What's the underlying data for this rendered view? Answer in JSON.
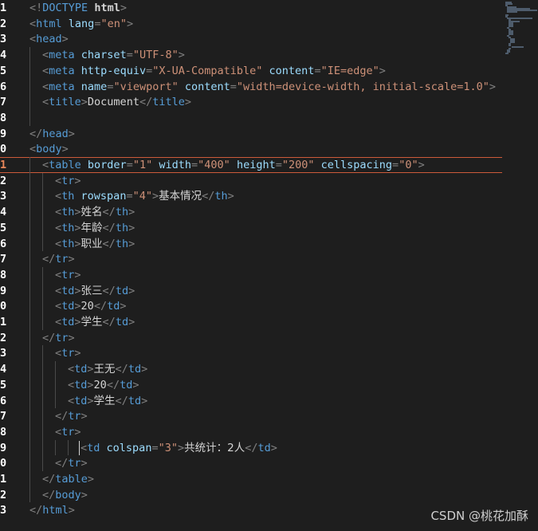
{
  "line_numbers": [
    "1",
    "2",
    "3",
    "4",
    "5",
    "6",
    "7",
    "8",
    "9",
    "0",
    "1",
    "2",
    "3",
    "4",
    "5",
    "6",
    "7",
    "8",
    "9",
    "0",
    "1",
    "2",
    "3",
    "4",
    "5",
    "6",
    "7",
    "8",
    "9",
    "0",
    "1",
    "2",
    "3"
  ],
  "active_line_index": 10,
  "watermark": "CSDN @桃花加酥",
  "lines": [
    {
      "indent": 0,
      "tokens": [
        [
          "punc",
          "<!"
        ],
        [
          "doc",
          "DOCTYPE"
        ],
        [
          "text",
          " "
        ],
        [
          "bold",
          "html"
        ],
        [
          "punc",
          ">"
        ]
      ]
    },
    {
      "indent": 0,
      "tokens": [
        [
          "punc",
          "<"
        ],
        [
          "tag",
          "html"
        ],
        [
          "text",
          " "
        ],
        [
          "attr",
          "lang"
        ],
        [
          "punc",
          "="
        ],
        [
          "str",
          "\"en\""
        ],
        [
          "punc",
          ">"
        ]
      ]
    },
    {
      "indent": 0,
      "tokens": [
        [
          "punc",
          "<"
        ],
        [
          "tag",
          "head"
        ],
        [
          "punc",
          ">"
        ]
      ]
    },
    {
      "indent": 1,
      "tokens": [
        [
          "punc",
          "<"
        ],
        [
          "tag",
          "meta"
        ],
        [
          "text",
          " "
        ],
        [
          "attr",
          "charset"
        ],
        [
          "punc",
          "="
        ],
        [
          "str",
          "\"UTF-8\""
        ],
        [
          "punc",
          ">"
        ]
      ]
    },
    {
      "indent": 1,
      "tokens": [
        [
          "punc",
          "<"
        ],
        [
          "tag",
          "meta"
        ],
        [
          "text",
          " "
        ],
        [
          "attr",
          "http-equiv"
        ],
        [
          "punc",
          "="
        ],
        [
          "str",
          "\"X-UA-Compatible\""
        ],
        [
          "text",
          " "
        ],
        [
          "attr",
          "content"
        ],
        [
          "punc",
          "="
        ],
        [
          "str",
          "\"IE=edge\""
        ],
        [
          "punc",
          ">"
        ]
      ]
    },
    {
      "indent": 1,
      "tokens": [
        [
          "punc",
          "<"
        ],
        [
          "tag",
          "meta"
        ],
        [
          "text",
          " "
        ],
        [
          "attr",
          "name"
        ],
        [
          "punc",
          "="
        ],
        [
          "str",
          "\"viewport\""
        ],
        [
          "text",
          " "
        ],
        [
          "attr",
          "content"
        ],
        [
          "punc",
          "="
        ],
        [
          "str",
          "\"width=device-width, initial-scale=1.0\""
        ],
        [
          "punc",
          ">"
        ]
      ]
    },
    {
      "indent": 1,
      "tokens": [
        [
          "punc",
          "<"
        ],
        [
          "tag",
          "title"
        ],
        [
          "punc",
          ">"
        ],
        [
          "text",
          "Document"
        ],
        [
          "punc",
          "</"
        ],
        [
          "tag",
          "title"
        ],
        [
          "punc",
          ">"
        ]
      ]
    },
    {
      "indent": 1,
      "tokens": []
    },
    {
      "indent": 0,
      "tokens": [
        [
          "punc",
          "</"
        ],
        [
          "tag",
          "head"
        ],
        [
          "punc",
          ">"
        ]
      ]
    },
    {
      "indent": 0,
      "tokens": [
        [
          "punc",
          "<"
        ],
        [
          "tag",
          "body"
        ],
        [
          "punc",
          ">"
        ]
      ]
    },
    {
      "indent": 1,
      "tokens": [
        [
          "punc",
          "<"
        ],
        [
          "tag",
          "table"
        ],
        [
          "text",
          " "
        ],
        [
          "attr",
          "border"
        ],
        [
          "punc",
          "="
        ],
        [
          "str",
          "\"1\""
        ],
        [
          "text",
          " "
        ],
        [
          "attr",
          "width"
        ],
        [
          "punc",
          "="
        ],
        [
          "str",
          "\"400\""
        ],
        [
          "text",
          " "
        ],
        [
          "attr",
          "height"
        ],
        [
          "punc",
          "="
        ],
        [
          "str",
          "\"200\""
        ],
        [
          "text",
          " "
        ],
        [
          "attr",
          "cellspacing"
        ],
        [
          "punc",
          "="
        ],
        [
          "str",
          "\"0\""
        ],
        [
          "punc",
          ">"
        ]
      ]
    },
    {
      "indent": 2,
      "tokens": [
        [
          "punc",
          "<"
        ],
        [
          "tag",
          "tr"
        ],
        [
          "punc",
          ">"
        ]
      ]
    },
    {
      "indent": 2,
      "tokens": [
        [
          "punc",
          "<"
        ],
        [
          "tag",
          "th"
        ],
        [
          "text",
          " "
        ],
        [
          "attr",
          "rowspan"
        ],
        [
          "punc",
          "="
        ],
        [
          "str",
          "\"4\""
        ],
        [
          "punc",
          ">"
        ],
        [
          "cjk",
          "基本情况"
        ],
        [
          "punc",
          "</"
        ],
        [
          "tag",
          "th"
        ],
        [
          "punc",
          ">"
        ]
      ]
    },
    {
      "indent": 2,
      "tokens": [
        [
          "punc",
          "<"
        ],
        [
          "tag",
          "th"
        ],
        [
          "punc",
          ">"
        ],
        [
          "cjk",
          "姓名"
        ],
        [
          "punc",
          "</"
        ],
        [
          "tag",
          "th"
        ],
        [
          "punc",
          ">"
        ]
      ]
    },
    {
      "indent": 2,
      "tokens": [
        [
          "punc",
          "<"
        ],
        [
          "tag",
          "th"
        ],
        [
          "punc",
          ">"
        ],
        [
          "cjk",
          "年龄"
        ],
        [
          "punc",
          "</"
        ],
        [
          "tag",
          "th"
        ],
        [
          "punc",
          ">"
        ]
      ]
    },
    {
      "indent": 2,
      "tokens": [
        [
          "punc",
          "<"
        ],
        [
          "tag",
          "th"
        ],
        [
          "punc",
          ">"
        ],
        [
          "cjk",
          "职业"
        ],
        [
          "punc",
          "</"
        ],
        [
          "tag",
          "th"
        ],
        [
          "punc",
          ">"
        ]
      ]
    },
    {
      "indent": 1,
      "tokens": [
        [
          "punc",
          "</"
        ],
        [
          "tag",
          "tr"
        ],
        [
          "punc",
          ">"
        ]
      ]
    },
    {
      "indent": 2,
      "tokens": [
        [
          "punc",
          "<"
        ],
        [
          "tag",
          "tr"
        ],
        [
          "punc",
          ">"
        ]
      ]
    },
    {
      "indent": 2,
      "tokens": [
        [
          "punc",
          "<"
        ],
        [
          "tag",
          "td"
        ],
        [
          "punc",
          ">"
        ],
        [
          "cjk",
          "张三"
        ],
        [
          "punc",
          "</"
        ],
        [
          "tag",
          "td"
        ],
        [
          "punc",
          ">"
        ]
      ]
    },
    {
      "indent": 2,
      "tokens": [
        [
          "punc",
          "<"
        ],
        [
          "tag",
          "td"
        ],
        [
          "punc",
          ">"
        ],
        [
          "text",
          "20"
        ],
        [
          "punc",
          "</"
        ],
        [
          "tag",
          "td"
        ],
        [
          "punc",
          ">"
        ]
      ]
    },
    {
      "indent": 2,
      "tokens": [
        [
          "punc",
          "<"
        ],
        [
          "tag",
          "td"
        ],
        [
          "punc",
          ">"
        ],
        [
          "cjk",
          "学生"
        ],
        [
          "punc",
          "</"
        ],
        [
          "tag",
          "td"
        ],
        [
          "punc",
          ">"
        ]
      ]
    },
    {
      "indent": 1,
      "tokens": [
        [
          "punc",
          "</"
        ],
        [
          "tag",
          "tr"
        ],
        [
          "punc",
          ">"
        ]
      ]
    },
    {
      "indent": 2,
      "tokens": [
        [
          "punc",
          "<"
        ],
        [
          "tag",
          "tr"
        ],
        [
          "punc",
          ">"
        ]
      ]
    },
    {
      "indent": 3,
      "tokens": [
        [
          "punc",
          "<"
        ],
        [
          "tag",
          "td"
        ],
        [
          "punc",
          ">"
        ],
        [
          "cjk",
          "王无"
        ],
        [
          "punc",
          "</"
        ],
        [
          "tag",
          "td"
        ],
        [
          "punc",
          ">"
        ]
      ]
    },
    {
      "indent": 3,
      "tokens": [
        [
          "punc",
          "<"
        ],
        [
          "tag",
          "td"
        ],
        [
          "punc",
          ">"
        ],
        [
          "text",
          "20"
        ],
        [
          "punc",
          "</"
        ],
        [
          "tag",
          "td"
        ],
        [
          "punc",
          ">"
        ]
      ]
    },
    {
      "indent": 3,
      "tokens": [
        [
          "punc",
          "<"
        ],
        [
          "tag",
          "td"
        ],
        [
          "punc",
          ">"
        ],
        [
          "cjk",
          "学生"
        ],
        [
          "punc",
          "</"
        ],
        [
          "tag",
          "td"
        ],
        [
          "punc",
          ">"
        ]
      ]
    },
    {
      "indent": 2,
      "tokens": [
        [
          "punc",
          "</"
        ],
        [
          "tag",
          "tr"
        ],
        [
          "punc",
          ">"
        ]
      ]
    },
    {
      "indent": 2,
      "tokens": [
        [
          "punc",
          "<"
        ],
        [
          "tag",
          "tr"
        ],
        [
          "punc",
          ">"
        ]
      ]
    },
    {
      "indent": 4,
      "tokens": [
        [
          "punc",
          "<"
        ],
        [
          "tag",
          "td"
        ],
        [
          "text",
          " "
        ],
        [
          "attr",
          "colspan"
        ],
        [
          "punc",
          "="
        ],
        [
          "str",
          "\"3\""
        ],
        [
          "punc",
          ">"
        ],
        [
          "cjk",
          "共统计：2人"
        ],
        [
          "punc",
          "</"
        ],
        [
          "tag",
          "td"
        ],
        [
          "punc",
          ">"
        ]
      ]
    },
    {
      "indent": 2,
      "tokens": [
        [
          "punc",
          "</"
        ],
        [
          "tag",
          "tr"
        ],
        [
          "punc",
          ">"
        ]
      ]
    },
    {
      "indent": 1,
      "tokens": [
        [
          "punc",
          "</"
        ],
        [
          "tag",
          "table"
        ],
        [
          "punc",
          ">"
        ]
      ]
    },
    {
      "indent": 1,
      "tokens": [
        [
          "punc",
          "</"
        ],
        [
          "tag",
          "body"
        ],
        [
          "punc",
          ">"
        ]
      ]
    },
    {
      "indent": 0,
      "tokens": [
        [
          "punc",
          "</"
        ],
        [
          "tag",
          "html"
        ],
        [
          "punc",
          ">"
        ]
      ]
    }
  ]
}
